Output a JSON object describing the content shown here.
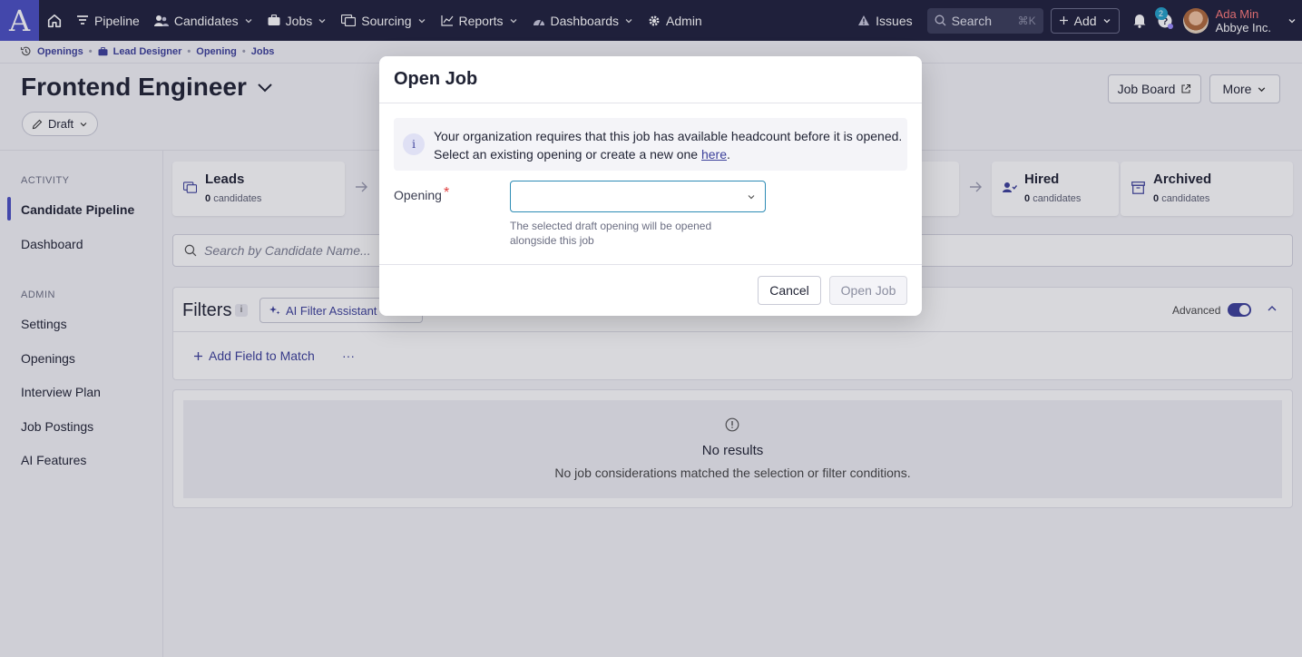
{
  "nav": {
    "logo": "A",
    "items": [
      {
        "label": "Pipeline",
        "icon": "filter-icon",
        "chevron": false
      },
      {
        "label": "Candidates",
        "icon": "users-icon",
        "chevron": true
      },
      {
        "label": "Jobs",
        "icon": "briefcase-icon",
        "chevron": true
      },
      {
        "label": "Sourcing",
        "icon": "sourcing-icon",
        "chevron": true
      },
      {
        "label": "Reports",
        "icon": "chart-icon",
        "chevron": true
      },
      {
        "label": "Dashboards",
        "icon": "gauge-icon",
        "chevron": true
      },
      {
        "label": "Admin",
        "icon": "gear-icon",
        "chevron": false
      }
    ],
    "issues_label": "Issues",
    "search_label": "Search",
    "search_shortcut": "⌘K",
    "add_label": "Add",
    "help_badge": "2",
    "user_name": "Ada Min",
    "user_org": "Abbye Inc."
  },
  "breadcrumbs": [
    "Openings",
    "Lead Designer",
    "Opening",
    "Jobs"
  ],
  "page": {
    "title": "Frontend Engineer",
    "status": "Draft",
    "job_board_label": "Job Board",
    "more_label": "More"
  },
  "sidebar": {
    "activity_heading": "ACTIVITY",
    "activity_items": [
      "Candidate Pipeline",
      "Dashboard"
    ],
    "admin_heading": "ADMIN",
    "admin_items": [
      "Settings",
      "Openings",
      "Interview Plan",
      "Job Postings",
      "AI Features"
    ]
  },
  "stages": [
    {
      "title": "Leads",
      "count": "0",
      "suffix": "candidates"
    },
    {
      "title": "Hired",
      "count": "0",
      "suffix": "candidates"
    },
    {
      "title": "Archived",
      "count": "0",
      "suffix": "candidates"
    }
  ],
  "candidate_search": {
    "placeholder": "Search by Candidate Name..."
  },
  "filters": {
    "title": "Filters",
    "info": "i",
    "ai_label": "AI Filter Assistant",
    "advanced_label": "Advanced",
    "advanced_on": true,
    "add_field_label": "Add Field to Match",
    "more_dots": "···"
  },
  "results": {
    "title": "No results",
    "subtitle": "No job considerations matched the selection or filter conditions."
  },
  "modal": {
    "title": "Open Job",
    "notice_line1": "Your organization requires that this job has available headcount before it is opened.",
    "notice_line2_prefix": "Select an existing opening or create a new one ",
    "notice_link": "here",
    "notice_suffix": ".",
    "info_glyph": "i",
    "opening_label": "Opening",
    "required_mark": "*",
    "opening_value": "",
    "opening_help": "The selected draft opening will be opened alongside this job",
    "cancel_label": "Cancel",
    "open_label": "Open Job"
  },
  "colors": {
    "nav_bg": "#1e1f3b",
    "brand": "#4a4fc4",
    "accent_link": "#3b3f9a",
    "required": "#e03e3e",
    "select_border": "#2d8cb5"
  }
}
